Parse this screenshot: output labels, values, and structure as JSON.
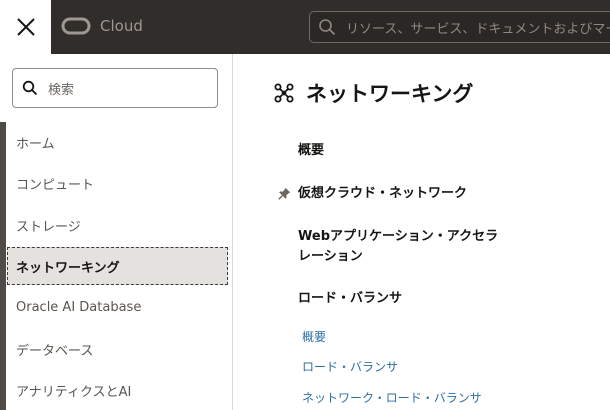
{
  "topbar": {
    "close_icon": "close-icon",
    "logo_icon": "oracle-logo-icon",
    "logo_text": "Cloud",
    "search": {
      "icon": "search-icon",
      "placeholder": "リソース、サービス、ドキュメントおよびマー"
    }
  },
  "sidebar": {
    "search": {
      "icon": "search-icon",
      "placeholder": "検索"
    },
    "items": [
      {
        "label": "ホーム",
        "active": false
      },
      {
        "label": "コンピュート",
        "active": false
      },
      {
        "label": "ストレージ",
        "active": false
      },
      {
        "label": "ネットワーキング",
        "active": true
      },
      {
        "label": "Oracle AI Database",
        "active": false
      },
      {
        "label": "データベース",
        "active": false
      },
      {
        "label": "アナリティクスとAI",
        "active": false
      }
    ]
  },
  "main": {
    "title_icon": "networking-icon",
    "title": "ネットワーキング",
    "sections": [
      {
        "label": "概要",
        "pinned": false
      },
      {
        "label": "仮想クラウド・ネットワーク",
        "pinned": true
      },
      {
        "label_line1": "Webアプリケーション・アクセラ",
        "label_line2": "レーション",
        "pinned": false
      },
      {
        "label": "ロード・バランサ",
        "pinned": false
      }
    ],
    "sublinks": [
      {
        "label": "概要"
      },
      {
        "label": "ロード・バランサ"
      },
      {
        "label": "ネットワーク・ロード・バランサ"
      }
    ]
  },
  "colors": {
    "topbar": "#312d2a",
    "link": "#2d6fa8",
    "active_bg": "#e4e2df"
  }
}
